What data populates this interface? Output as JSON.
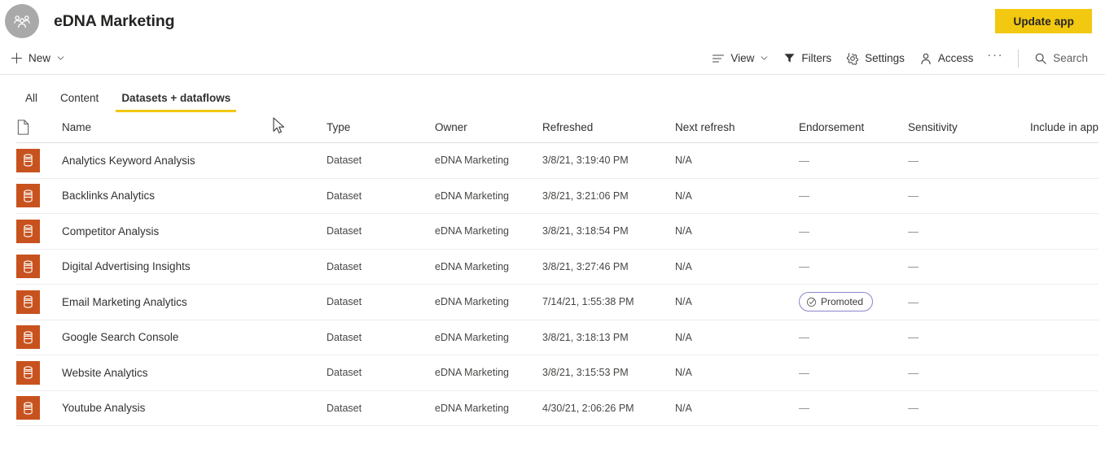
{
  "header": {
    "workspace_icon": "group-people-icon",
    "title": "eDNA Marketing",
    "update_app_label": "Update app",
    "accent_yellow": "#f2c811",
    "avatar_bg": "#a9a9a9"
  },
  "commandbar": {
    "new_label": "New",
    "view_label": "View",
    "filters_label": "Filters",
    "settings_label": "Settings",
    "access_label": "Access",
    "more_label": "···",
    "search_label": "Search"
  },
  "tabs": [
    {
      "label": "All",
      "active": false
    },
    {
      "label": "Content",
      "active": false
    },
    {
      "label": "Datasets + dataflows",
      "active": true
    }
  ],
  "table": {
    "columns": {
      "icon": "file-icon",
      "name": "Name",
      "type": "Type",
      "owner": "Owner",
      "refreshed": "Refreshed",
      "next_refresh": "Next refresh",
      "endorsement": "Endorsement",
      "sensitivity": "Sensitivity",
      "include_in_app": "Include in app"
    },
    "dash": "—",
    "item_icon_color": "#c8521e",
    "rows": [
      {
        "icon": "dataset-icon",
        "name": "Analytics Keyword Analysis",
        "type": "Dataset",
        "owner": "eDNA Marketing",
        "refreshed": "3/8/21, 3:19:40 PM",
        "next_refresh": "N/A",
        "endorsement": "—",
        "sensitivity": "—",
        "include_in_app": ""
      },
      {
        "icon": "dataset-icon",
        "name": "Backlinks Analytics",
        "type": "Dataset",
        "owner": "eDNA Marketing",
        "refreshed": "3/8/21, 3:21:06 PM",
        "next_refresh": "N/A",
        "endorsement": "—",
        "sensitivity": "—",
        "include_in_app": ""
      },
      {
        "icon": "dataset-icon",
        "name": "Competitor Analysis",
        "type": "Dataset",
        "owner": "eDNA Marketing",
        "refreshed": "3/8/21, 3:18:54 PM",
        "next_refresh": "N/A",
        "endorsement": "—",
        "sensitivity": "—",
        "include_in_app": ""
      },
      {
        "icon": "dataset-icon",
        "name": "Digital Advertising Insights",
        "type": "Dataset",
        "owner": "eDNA Marketing",
        "refreshed": "3/8/21, 3:27:46 PM",
        "next_refresh": "N/A",
        "endorsement": "—",
        "sensitivity": "—",
        "include_in_app": ""
      },
      {
        "icon": "dataset-icon",
        "name": "Email Marketing Analytics",
        "type": "Dataset",
        "owner": "eDNA Marketing",
        "refreshed": "7/14/21, 1:55:38 PM",
        "next_refresh": "N/A",
        "endorsement": "Promoted",
        "endorsement_badge": true,
        "sensitivity": "—",
        "include_in_app": ""
      },
      {
        "icon": "dataset-icon",
        "name": "Google Search Console",
        "type": "Dataset",
        "owner": "eDNA Marketing",
        "refreshed": "3/8/21, 3:18:13 PM",
        "next_refresh": "N/A",
        "endorsement": "—",
        "sensitivity": "—",
        "include_in_app": ""
      },
      {
        "icon": "dataset-icon",
        "name": "Website Analytics",
        "type": "Dataset",
        "owner": "eDNA Marketing",
        "refreshed": "3/8/21, 3:15:53 PM",
        "next_refresh": "N/A",
        "endorsement": "—",
        "sensitivity": "—",
        "include_in_app": ""
      },
      {
        "icon": "dataset-icon",
        "name": "Youtube Analysis",
        "type": "Dataset",
        "owner": "eDNA Marketing",
        "refreshed": "4/30/21, 2:06:26 PM",
        "next_refresh": "N/A",
        "endorsement": "—",
        "sensitivity": "—",
        "include_in_app": ""
      }
    ]
  }
}
